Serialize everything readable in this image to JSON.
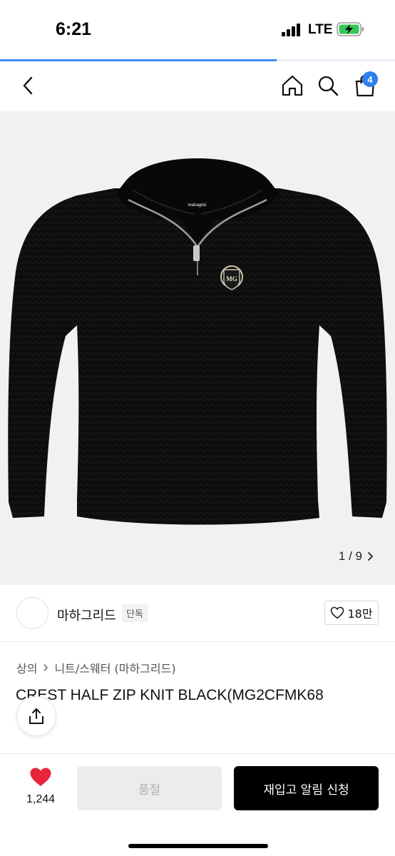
{
  "status_bar": {
    "time": "6:21",
    "network": "LTE"
  },
  "page_load_progress": 0.7,
  "nav": {
    "cart_count": "4"
  },
  "gallery": {
    "current": "1",
    "separator": "/",
    "total": "9",
    "counter_text": "1 / 9",
    "product_label": "mahagrid."
  },
  "brand": {
    "name": "마하그리드",
    "tag": "단독",
    "likes": "18만"
  },
  "breadcrumb": {
    "items": [
      "상의",
      "니트/스웨터 (마하그리드)"
    ]
  },
  "product": {
    "title": "CREST HALF ZIP KNIT BLACK(MG2CFMK68"
  },
  "bottom_bar": {
    "wish_count": "1,244",
    "soldout_label": "품절",
    "restock_label": "재입고 알림 신청"
  },
  "colors": {
    "accent_blue": "#2f80ed",
    "heart_red": "#e8243a",
    "primary_black": "#000000"
  },
  "icons": {
    "back": "chevron-left-icon",
    "home": "home-icon",
    "search": "search-icon",
    "cart": "shopping-bag-icon",
    "like": "heart-outline-icon",
    "wish": "heart-filled-icon",
    "share": "share-icon",
    "next": "chevron-right-icon"
  }
}
